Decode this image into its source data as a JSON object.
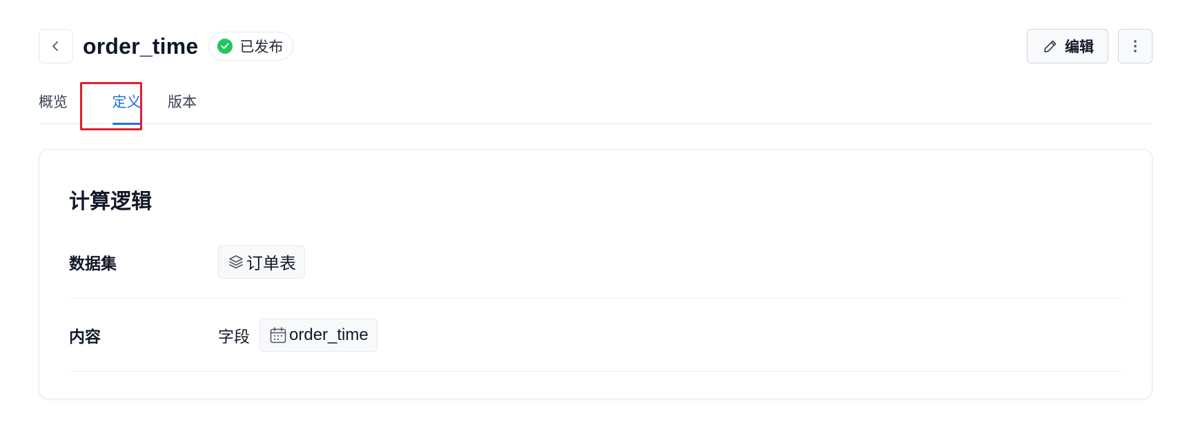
{
  "header": {
    "title": "order_time",
    "status": "已发布",
    "edit_label": "编辑"
  },
  "tabs": [
    {
      "label": "概览"
    },
    {
      "label": "定义",
      "active": true
    },
    {
      "label": "版本"
    }
  ],
  "card": {
    "title": "计算逻辑",
    "dataset": {
      "label": "数据集",
      "value": "订单表",
      "icon": "layers-icon"
    },
    "content": {
      "label": "内容",
      "prefix": "字段",
      "value": "order_time",
      "icon": "calendar-icon"
    }
  },
  "colors": {
    "accent": "#1d6fe0",
    "success": "#22c55e",
    "highlight": "#e11d2a"
  }
}
